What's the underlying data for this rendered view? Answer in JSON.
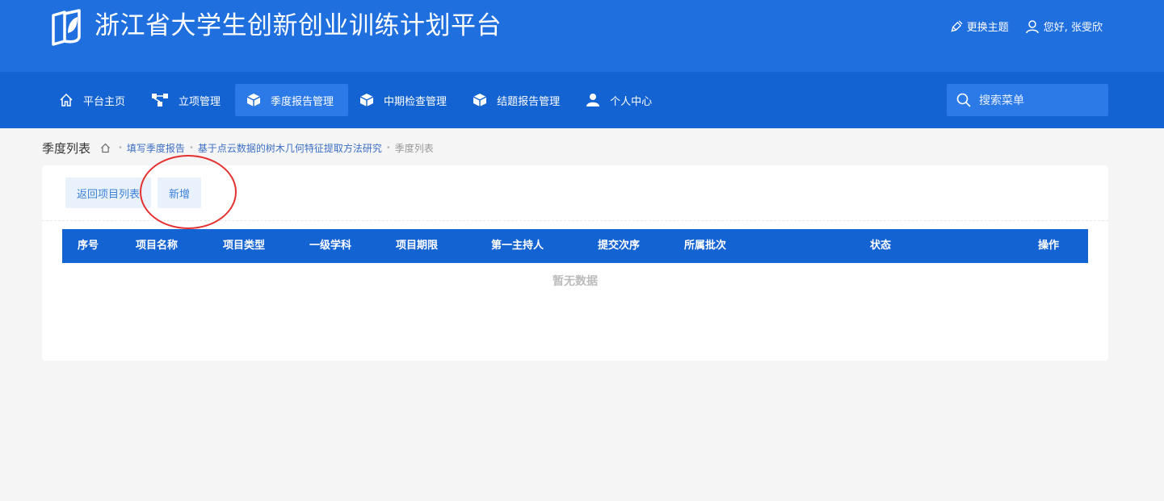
{
  "header": {
    "title": "浙江省大学生创新创业训练计划平台",
    "theme_label": "更换主题",
    "user_greeting": "您好, 张雯欣"
  },
  "nav": {
    "items": [
      {
        "label": "平台主页",
        "icon": "home-icon"
      },
      {
        "label": "立项管理",
        "icon": "hierarchy-icon"
      },
      {
        "label": "季度报告管理",
        "icon": "cube-icon",
        "active": true
      },
      {
        "label": "中期检查管理",
        "icon": "cube-icon"
      },
      {
        "label": "结题报告管理",
        "icon": "cube-icon"
      },
      {
        "label": "个人中心",
        "icon": "user-icon"
      }
    ],
    "search_placeholder": "搜索菜单"
  },
  "breadcrumb": {
    "page_title": "季度列表",
    "link1": "填写季度报告",
    "link2": "基于点云数据的树木几何特征提取方法研究",
    "current": "季度列表"
  },
  "toolbar": {
    "back_label": "返回项目列表",
    "add_label": "新增"
  },
  "table": {
    "columns": [
      "序号",
      "项目名称",
      "项目类型",
      "一级学科",
      "项目期限",
      "第一主持人",
      "提交次序",
      "所属批次",
      "状态",
      "操作"
    ],
    "empty_text": "暂无数据"
  },
  "colors": {
    "header_bg": "#1f6fdf",
    "nav_bg": "#1463d3",
    "table_head_bg": "#1463d3",
    "annotation_circle": "#e53030"
  }
}
